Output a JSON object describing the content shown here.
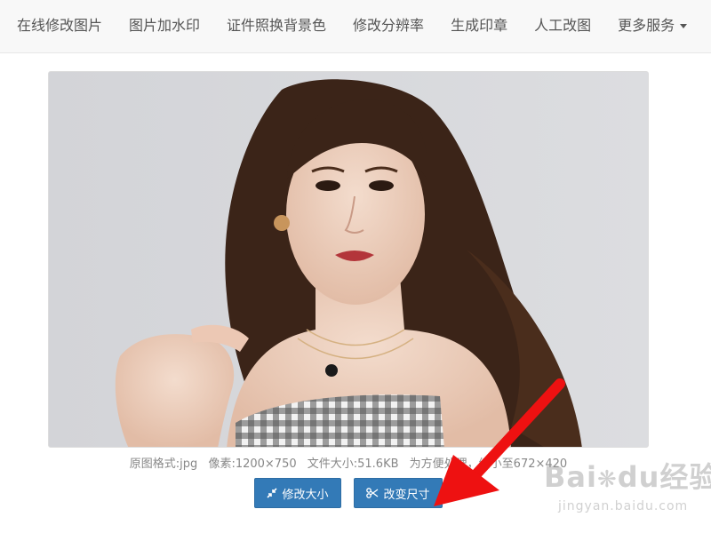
{
  "nav": {
    "items": [
      {
        "label": "在线修改图片"
      },
      {
        "label": "图片加水印"
      },
      {
        "label": "证件照换背景色"
      },
      {
        "label": "修改分辨率"
      },
      {
        "label": "生成印章"
      },
      {
        "label": "人工改图"
      },
      {
        "label": "更多服务"
      }
    ]
  },
  "photo": {
    "icon": "portrait-photo"
  },
  "info": {
    "format": "原图格式:jpg",
    "pixels": "像素:1200×750",
    "filesize": "文件大小:51.6KB",
    "note": "为方便处理，缩小至672×420"
  },
  "buttons": {
    "resize_label": "修改大小",
    "crop_label": "改变尺寸",
    "resize_icon": "compress-icon",
    "crop_icon": "scissors-icon"
  },
  "watermark": {
    "brand": "Bai",
    "brand2": "经验",
    "url": "jingyan.baidu.com"
  },
  "colors": {
    "nav_bg": "#f8f8f8",
    "nav_text": "#555555",
    "button_primary": "#337ab7",
    "arrow": "#ee1111",
    "info_text": "#888888"
  }
}
